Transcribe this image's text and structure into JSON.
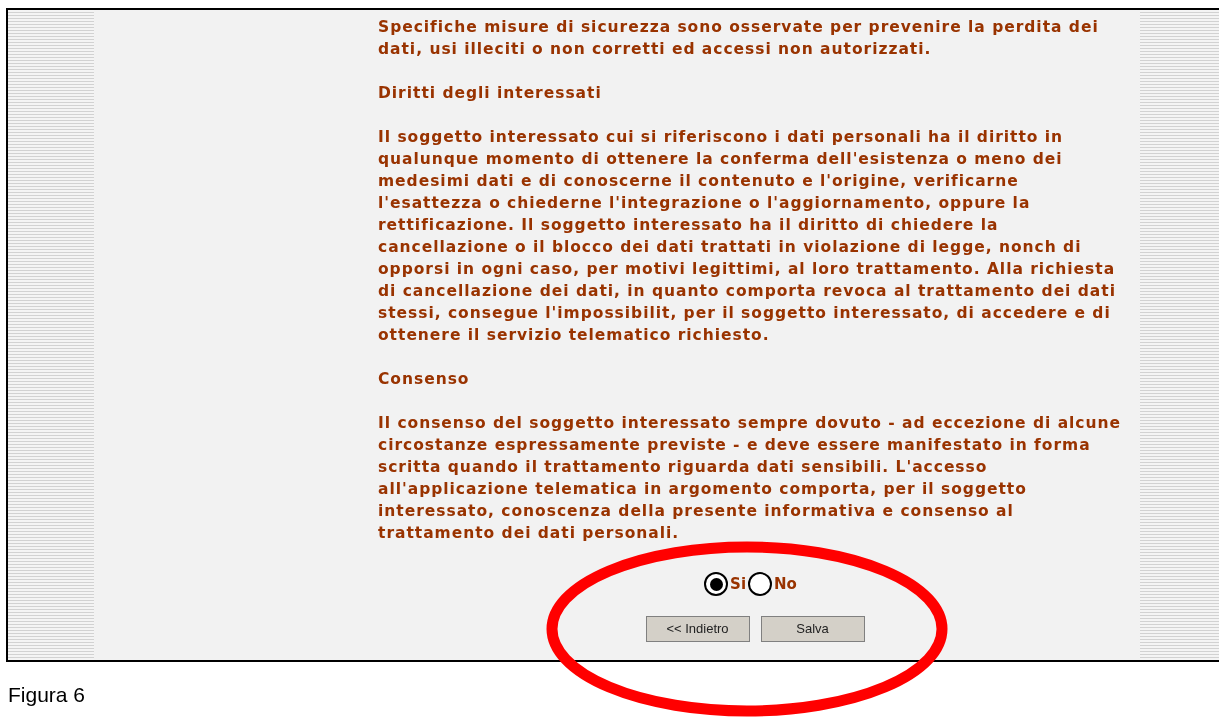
{
  "blocks": [
    {
      "text": "Specifiche misure di sicurezza sono osservate per prevenire la perdita dei dati, usi illeciti o non corretti ed accessi non autorizzati."
    },
    {
      "heading": "Diritti degli interessati",
      "text": "Il soggetto interessato cui si riferiscono i dati personali ha il diritto in qualunque momento di ottenere la conferma dell'esistenza o meno dei medesimi dati e di conoscerne il contenuto e l'origine, verificarne l'esattezza o chiederne l'integrazione o l'aggiornamento, oppure la rettificazione. Il soggetto interessato ha il diritto di chiedere la cancellazione o il blocco dei dati trattati in violazione di legge, nonch di opporsi in ogni caso, per motivi legittimi, al loro trattamento. Alla richiesta di cancellazione dei dati, in quanto comporta revoca al trattamento dei dati stessi, consegue l'impossibilit, per il soggetto interessato, di accedere e di ottenere il servizio telematico richiesto."
    },
    {
      "heading": "Consenso",
      "text": "Il consenso del soggetto interessato sempre dovuto - ad eccezione di alcune circostanze espressamente previste - e deve essere manifestato in forma scritta quando il trattamento riguarda dati sensibili. L'accesso all'applicazione telematica in argomento comporta, per il soggetto interessato, conoscenza della presente informativa e consenso al trattamento dei dati personali."
    }
  ],
  "consent_options": [
    {
      "label": "Si",
      "selected": true
    },
    {
      "label": "No",
      "selected": false
    }
  ],
  "buttons": [
    "<< Indietro",
    "Salva"
  ],
  "caption": "Figura 6"
}
